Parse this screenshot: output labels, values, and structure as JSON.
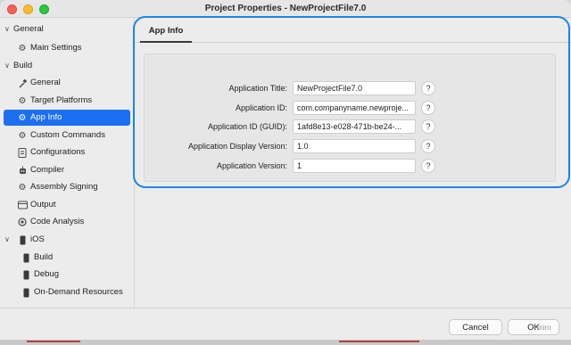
{
  "window": {
    "title": "Project Properties - NewProjectFile7.0"
  },
  "sidebar": {
    "sections": [
      {
        "label": "General",
        "expanded": true
      },
      {
        "label": "Build",
        "expanded": true
      }
    ],
    "items": [
      {
        "label": "Main Settings",
        "icon": "gear-icon"
      },
      {
        "label": "General",
        "icon": "hammer-icon"
      },
      {
        "label": "Target Platforms",
        "icon": "gear-icon"
      },
      {
        "label": "App Info",
        "icon": "gear-icon",
        "selected": true
      },
      {
        "label": "Custom Commands",
        "icon": "gear-icon"
      },
      {
        "label": "Configurations",
        "icon": "document-icon"
      },
      {
        "label": "Compiler",
        "icon": "robot-icon"
      },
      {
        "label": "Assembly Signing",
        "icon": "gear-icon"
      },
      {
        "label": "Output",
        "icon": "folder-icon"
      },
      {
        "label": "Code Analysis",
        "icon": "circle-icon"
      },
      {
        "label": "iOS",
        "icon": "phone-icon"
      },
      {
        "label": "Build",
        "icon": "phone-icon"
      },
      {
        "label": "Debug",
        "icon": "phone-icon"
      },
      {
        "label": "On-Demand Resources",
        "icon": "phone-icon"
      }
    ]
  },
  "main": {
    "tab": "App Info",
    "fields": [
      {
        "label": "Application Title:",
        "value": "NewProjectFile7.0",
        "help": "?"
      },
      {
        "label": "Application ID:",
        "value": "com.companyname.newproje...",
        "help": "?"
      },
      {
        "label": "Application ID (GUID):",
        "value": "1afd8e13-e028-471b-be24-...",
        "help": "?"
      },
      {
        "label": "Application Display Version:",
        "value": "1.0",
        "help": "?"
      },
      {
        "label": "Application Version:",
        "value": "1",
        "help": "?"
      }
    ]
  },
  "footer": {
    "cancel": "Cancel",
    "ok": "OK",
    "watermark": "miro"
  },
  "colors": {
    "accent": "#1d6ff2",
    "highlight_outline": "#1d86e4"
  }
}
